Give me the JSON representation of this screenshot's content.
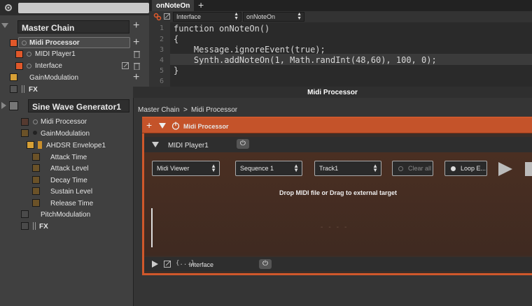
{
  "tree": {
    "master_chain": "Master Chain",
    "midi_processor": "Midi Processor",
    "midi_player": "MIDI Player1",
    "interface": "Interface",
    "gain_modulation": "GainModulation",
    "fx": "FX",
    "sine_gen": "Sine Wave Generator1",
    "sub_midi_processor": "Midi Processor",
    "sub_gain_mod": "GainModulation",
    "envelope": "AHDSR Envelope1",
    "attack_time": "Attack Time",
    "attack_level": "Attack Level",
    "decay_time": "Decay Time",
    "sustain_level": "Sustain Level",
    "release_time": "Release Time",
    "pitch_mod": "PitchModulation",
    "sub_fx": "FX"
  },
  "editor": {
    "tab": "onNoteOn",
    "combo_file": "Interface",
    "combo_callback": "onNoteOn",
    "line_numbers": [
      "1",
      "2",
      "3",
      "4",
      "5",
      "6"
    ],
    "lines": [
      "function onNoteOn()",
      "{",
      "    Message.ignoreEvent(true);",
      "    Synth.addNoteOn(1, Math.randInt(48,60), 100, 0);",
      "}",
      ""
    ]
  },
  "window": {
    "title": "Midi Processor",
    "crumb1": "Master Chain",
    "crumb_sep": ">",
    "crumb2": "Midi Processor",
    "module_name": "Midi Processor",
    "player_name": "MIDI Player1",
    "viewer_select": "Midi Viewer",
    "sequence_select": "Sequence 1",
    "track_select": "Track1",
    "clear_all": "Clear all",
    "loop": "Loop E...",
    "drop_text": "Drop MIDI file or Drag to external target",
    "interface_label": "Interface",
    "script_icon_text": "{...}"
  },
  "colors": {
    "accent_orange": "#d0582b",
    "swatch_orange": "#e0582a",
    "swatch_gold": "#d7a036",
    "swatch_gray": "#555555"
  }
}
